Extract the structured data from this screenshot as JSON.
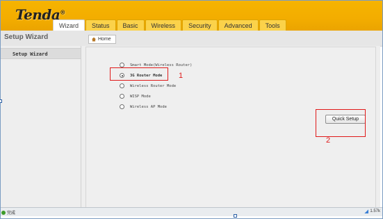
{
  "header": {
    "logo": "Tenda",
    "logo_reg": "®",
    "tabs": [
      {
        "label": "Wizard",
        "active": true
      },
      {
        "label": "Status",
        "active": false
      },
      {
        "label": "Basic",
        "active": false
      },
      {
        "label": "Wireless",
        "active": false
      },
      {
        "label": "Security",
        "active": false
      },
      {
        "label": "Advanced",
        "active": false
      },
      {
        "label": "Tools",
        "active": false
      }
    ]
  },
  "sidebar": {
    "title": "Setup Wizard",
    "items": [
      {
        "label": "Setup Wizard"
      }
    ]
  },
  "breadcrumb": {
    "home_label": "Home",
    "home_icon": "home-icon"
  },
  "modes": [
    {
      "label": "Smart Mode(Wireless Router)",
      "selected": false
    },
    {
      "label": "3G Router Mode",
      "selected": true
    },
    {
      "label": "Wireless Router Mode",
      "selected": false
    },
    {
      "label": "WISP Mode",
      "selected": false
    },
    {
      "label": "Wireless AP Mode",
      "selected": false
    }
  ],
  "quick_setup_label": "Quick Setup",
  "annotations": [
    "1",
    "2"
  ],
  "statusbar": {
    "left_text": "完成",
    "right_text": "1.57k"
  },
  "colors": {
    "header": "#f3ad00",
    "annotation": "#e01919"
  }
}
